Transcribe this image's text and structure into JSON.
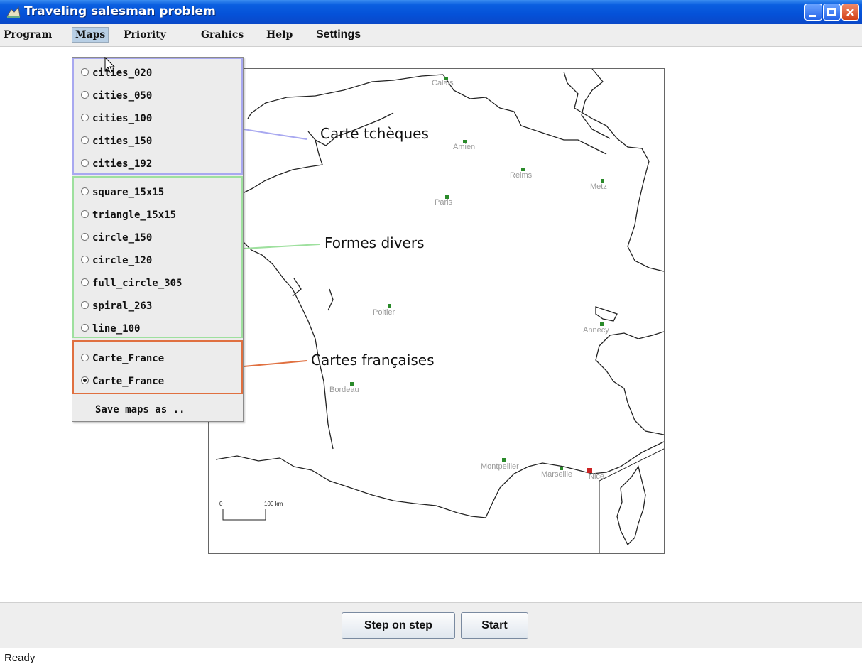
{
  "window": {
    "title": "Traveling salesman problem"
  },
  "menubar": {
    "items": [
      "Program",
      "Maps",
      "Priority",
      "Grahics",
      "Help",
      "Settings"
    ]
  },
  "maps_menu": {
    "czech_items": [
      "cities_020",
      "cities_050",
      "cities_100",
      "cities_150",
      "cities_192"
    ],
    "shape_items": [
      "square_15x15",
      "triangle_15x15",
      "circle_150",
      "circle_120",
      "full_circle_305",
      "spiral_263",
      "line_100"
    ],
    "france_items": [
      "Carte_France",
      "Carte_France"
    ],
    "selected": "Carte_France (2nd)",
    "save_label": "Save maps as .."
  },
  "annotations": {
    "czech": "Carte tchèques",
    "shapes": "Formes divers",
    "french": "Cartes françaises"
  },
  "map": {
    "cities": [
      "Calais",
      "Amien",
      "Reims",
      "Metz",
      "Paris",
      "Poitier",
      "Annecy",
      "Bordeau",
      "Montpellier",
      "Marseille",
      "Nice"
    ],
    "scale_zero": "0",
    "scale_label": "100 km"
  },
  "buttons": {
    "step": "Step on step",
    "start": "Start"
  },
  "status": {
    "text": "Ready"
  },
  "colors": {
    "czech_group": "#a8a8f0",
    "shape_group": "#9ee09e",
    "france_group": "#e07040",
    "city": "#2a8a2a",
    "current_city": "#cc2222"
  }
}
